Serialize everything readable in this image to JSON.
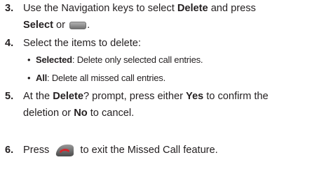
{
  "steps": [
    {
      "number": "3.",
      "line1": {
        "t1": "Use the Navigation keys to select ",
        "b1": "Delete",
        "t2": " and press"
      },
      "line2": {
        "b1": "Select",
        "t1": " or ",
        "t2": "."
      },
      "select_key_icon": "select-key-icon"
    },
    {
      "number": "4.",
      "line1": "Select the items to delete:",
      "options": [
        {
          "bullet": "•",
          "label": "Selected",
          "desc": ": Delete only selected call entries."
        },
        {
          "bullet": "•",
          "label": "All",
          "desc": ": Delete all missed call entries."
        }
      ]
    },
    {
      "number": "5.",
      "line1": {
        "t1": "At the ",
        "b1": "Delete",
        "t2": "? prompt, press either ",
        "b2": "Yes",
        "t3": " to confirm the"
      },
      "line2": {
        "t1": "deletion or ",
        "b1": "No",
        "t2": " to cancel."
      }
    },
    {
      "number": "6.",
      "line1": {
        "t1": "Press ",
        "t2": " to exit the Missed Call feature."
      },
      "end_key_icon": "end-key-icon"
    }
  ],
  "colors": {
    "text": "#231f20",
    "end_key_red": "#d8232a",
    "key_gray": "#8a8a8a"
  }
}
